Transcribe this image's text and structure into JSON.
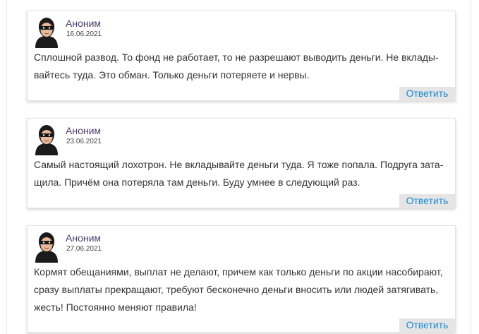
{
  "comments": [
    {
      "author": "Аноним",
      "date": "16.06.2021",
      "text": "Сплошной развод. То фонд не работает, то не разрешают выводить деньги. Не вклады-\nвайтесь туда. Это обман. Только деньги потеряете и нервы.",
      "reply_label": "Ответить",
      "avatar_icon": "anonymous-user-icon"
    },
    {
      "author": "Аноним",
      "date": "23.06.2021",
      "text": "Самый настоящий лохотрон. Не вкладывайте деньги туда. Я тоже попала. Подруга зата-\nщила. Причём она потеряла там деньги. Буду умнее в следующий раз.",
      "reply_label": "Ответить",
      "avatar_icon": "anonymous-user-icon"
    },
    {
      "author": "Аноним",
      "date": "27.06.2021",
      "text": "Кормят обещаниями, выплат не делают, причем как только деньги по акции насобирают,\nсразу выплаты прекращают, требуют бесконечно деньги вносить или людей затягивать,\nжесть! Постоянно меняют правила!",
      "reply_label": "Ответить",
      "avatar_icon": "anonymous-user-icon"
    }
  ],
  "colors": {
    "author": "#4b3f6b",
    "reply_text": "#1a8ad4",
    "reply_bg": "#e5e5e5"
  }
}
